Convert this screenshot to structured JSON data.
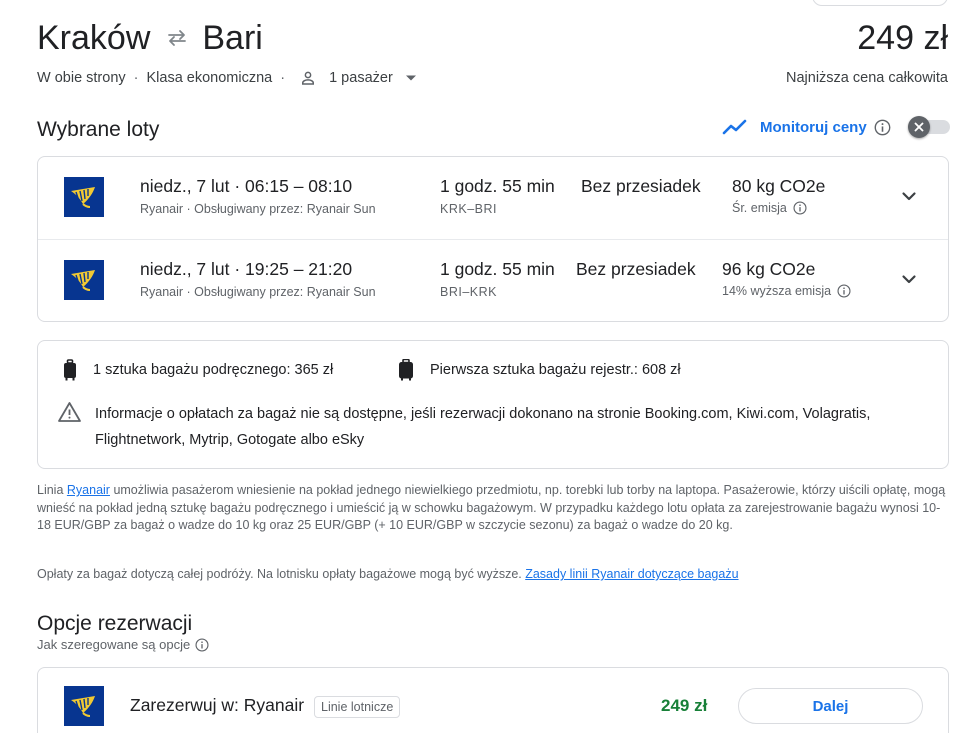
{
  "header": {
    "origin": "Kraków",
    "destination": "Bari",
    "price": "249 zł",
    "trip_type": "W obie strony",
    "cabin_class": "Klasa ekonomiczna",
    "passengers": "1 pasażer",
    "price_note": "Najniższa cena całkowita"
  },
  "selected": {
    "title": "Wybrane loty",
    "monitor_label": "Monitoruj ceny",
    "monitor_enabled": false
  },
  "flights": [
    {
      "date_time": "niedz., 7 lut  ·  06:15 – 08:10",
      "airline_line": "Ryanair · Obsługiwany przez: Ryanair Sun",
      "duration": "1 godz. 55 min",
      "route": "KRK–BRI",
      "stops": "Bez przesiadek",
      "emissions": "80 kg CO2e",
      "emissions_note": "Śr. emisja"
    },
    {
      "date_time": "niedz., 7 lut  ·  19:25 – 21:20",
      "airline_line": "Ryanair · Obsługiwany przez: Ryanair Sun",
      "duration": "1 godz. 55 min",
      "route": "BRI–KRK",
      "stops": "Bez przesiadek",
      "emissions": "96 kg CO2e",
      "emissions_note": "14% wyższa emisja"
    }
  ],
  "baggage": {
    "carry_on": "1 sztuka bagażu podręcznego: 365 zł",
    "checked": "Pierwsza sztuka bagażu rejestr.: 608 zł",
    "notice": "Informacje o opłatach za bagaż nie są dostępne, jeśli rezerwacji dokonano na stronie Booking.com, Kiwi.com, Volagratis, Flightnetwork, Mytrip, Gotogate albo eSky"
  },
  "policy": {
    "prefix": "Linia ",
    "airline_link": "Ryanair",
    "text": " umożliwia pasażerom wniesienie na pokład jednego niewielkiego przedmiotu, np. torebki lub torby na laptopa. Pasażerowie, którzy uiścili opłatę, mogą wnieść na pokład jedną sztukę bagażu podręcznego i umieścić ją w schowku bagażowym. W przypadku każdego lotu opłata za zarejestrowanie bagażu wynosi 10-18 EUR/GBP za bagaż o wadze do 10 kg oraz 25 EUR/GBP (+ 10 EUR/GBP w szczycie sezonu) za bagaż o wadze do 20 kg.",
    "fees_text": "Opłaty za bagaż dotyczą całej podróży. Na lotnisku opłaty bagażowe mogą być wyższe. ",
    "fees_link": "Zasady linii Ryanair dotyczące bagażu"
  },
  "booking": {
    "title": "Opcje rezerwacji",
    "sort_note": "Jak szeregowane są opcje",
    "option_label": "Zarezerwuj w: Ryanair",
    "option_tag": "Linie lotnicze",
    "option_price": "249 zł",
    "button_label": "Dalej"
  },
  "colors": {
    "accent": "#1a73e8",
    "price_green": "#188038",
    "ryanair_blue": "#073590",
    "ryanair_yellow": "#f1c933"
  }
}
